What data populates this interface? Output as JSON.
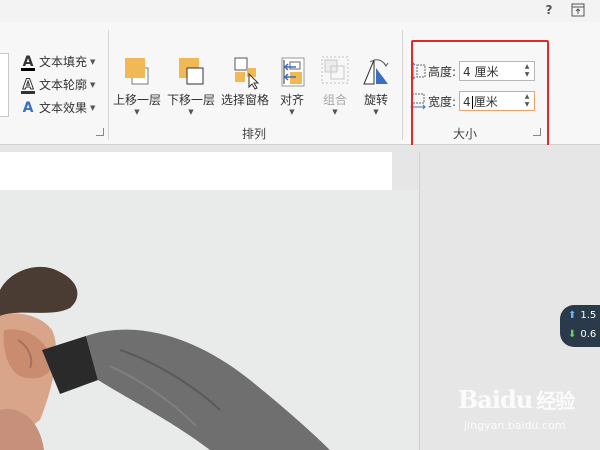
{
  "window": {
    "help_icon": "?",
    "restore_icon": "ribbon-display-icon"
  },
  "text_effects": {
    "items": [
      {
        "label": "文本填充",
        "icon": "text-fill-icon"
      },
      {
        "label": "文本轮廓",
        "icon": "text-outline-icon"
      },
      {
        "label": "文本效果",
        "icon": "text-effects-icon"
      }
    ]
  },
  "arrange": {
    "group_label": "排列",
    "buttons": [
      {
        "label": "上移一层",
        "icon": "bring-forward-icon",
        "enabled": true
      },
      {
        "label": "下移一层",
        "icon": "send-backward-icon",
        "enabled": true
      },
      {
        "label": "选择窗格",
        "icon": "selection-pane-icon",
        "enabled": true
      },
      {
        "label": "对齐",
        "icon": "align-icon",
        "enabled": true
      },
      {
        "label": "组合",
        "icon": "group-icon",
        "enabled": false
      },
      {
        "label": "旋转",
        "icon": "rotate-icon",
        "enabled": true
      }
    ]
  },
  "size": {
    "group_label": "大小",
    "height_label": "高度:",
    "height_value": "4 厘米",
    "width_label": "宽度:",
    "width_value_before_caret": "4",
    "width_value_after_caret": "厘米"
  },
  "speed_widget": {
    "up": "1.5",
    "down": "0.6"
  },
  "watermark": {
    "brand": "Bai",
    "brand_suffix": "经验",
    "url": "jingyan.baidu.com"
  },
  "colors": {
    "accent_orange": "#f0b955",
    "highlight_red": "#e0292b",
    "sweater": "#6f6f6f"
  }
}
